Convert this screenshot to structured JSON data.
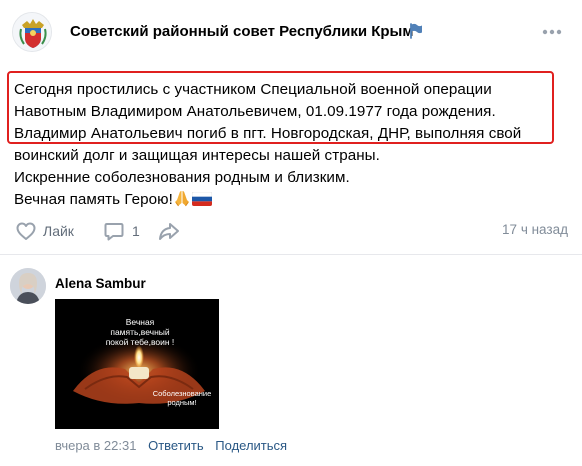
{
  "header": {
    "community_name": "Советский районный совет Республики Крым",
    "verified_icon": "flag-icon",
    "more_icon": "more-horizontal-icon"
  },
  "post": {
    "lines": [
      "Сегодня простились с участником Специальной военной операции",
      "Навотным Владимиром  Анатольевичем,  01.09.1977 года рождения.",
      "Владимир Анатольевич погиб  в пгт. Новгородская, ДНР,  выполняя свой",
      "воинский долг и защищая интересы нашей страны.",
      "Искренние соболезнования родным и близким.",
      "Вечная память Герою!"
    ],
    "emojis": [
      "folded-hands-icon",
      "russian-flag-icon"
    ]
  },
  "actions": {
    "like_label": "Лайк",
    "comment_count": "1",
    "time": "17 ч назад"
  },
  "comment": {
    "author": "Alena Sambur",
    "image_text_top": "Вечная\nпамять,вечный\nпокой тебе,воин !",
    "image_text_bottom": "Соболезнование\nродным!",
    "time": "вчера в 22:31",
    "reply_label": "Ответить",
    "share_label": "Поделиться"
  },
  "colors": {
    "highlight": "#e0201f",
    "link": "#2a5885",
    "muted": "#818c99",
    "icon": "#626d7a"
  }
}
